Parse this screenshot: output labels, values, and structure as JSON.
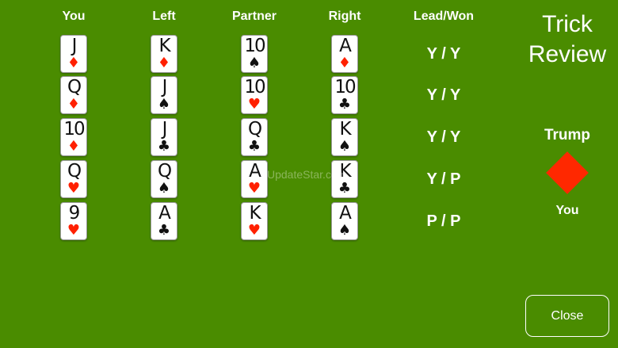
{
  "headers": {
    "you": "You",
    "left": "Left",
    "partner": "Partner",
    "right": "Right",
    "lead_won": "Lead/Won"
  },
  "tricks": [
    {
      "you": {
        "rank": "J",
        "suit": "♦"
      },
      "left": {
        "rank": "K",
        "suit": "♦"
      },
      "partner": {
        "rank": "10",
        "suit": "♠"
      },
      "right": {
        "rank": "A",
        "suit": "♦"
      },
      "lead_won": "Y / Y"
    },
    {
      "you": {
        "rank": "Q",
        "suit": "♦"
      },
      "left": {
        "rank": "J",
        "suit": "♠"
      },
      "partner": {
        "rank": "10",
        "suit": "♥"
      },
      "right": {
        "rank": "10",
        "suit": "♣"
      },
      "lead_won": "Y / Y"
    },
    {
      "you": {
        "rank": "10",
        "suit": "♦"
      },
      "left": {
        "rank": "J",
        "suit": "♣"
      },
      "partner": {
        "rank": "Q",
        "suit": "♣"
      },
      "right": {
        "rank": "K",
        "suit": "♠"
      },
      "lead_won": "Y / Y"
    },
    {
      "you": {
        "rank": "Q",
        "suit": "♥"
      },
      "left": {
        "rank": "Q",
        "suit": "♠"
      },
      "partner": {
        "rank": "A",
        "suit": "♥"
      },
      "right": {
        "rank": "K",
        "suit": "♣"
      },
      "lead_won": "Y / P"
    },
    {
      "you": {
        "rank": "9",
        "suit": "♥"
      },
      "left": {
        "rank": "A",
        "suit": "♣"
      },
      "partner": {
        "rank": "K",
        "suit": "♥"
      },
      "right": {
        "rank": "A",
        "suit": "♠"
      },
      "lead_won": "P / P"
    }
  ],
  "panel": {
    "title_line1": "Trick",
    "title_line2": "Review",
    "trump_label": "Trump",
    "trump_suit_icon": "diamond-suit-icon",
    "trump_player": "You",
    "close_label": "Close"
  },
  "watermark": "UpdateStar.com",
  "colors": {
    "table_green": "#4a8c00",
    "red_suit": "#ff2000",
    "black_suit": "#111111",
    "trump": "#ff2800"
  }
}
